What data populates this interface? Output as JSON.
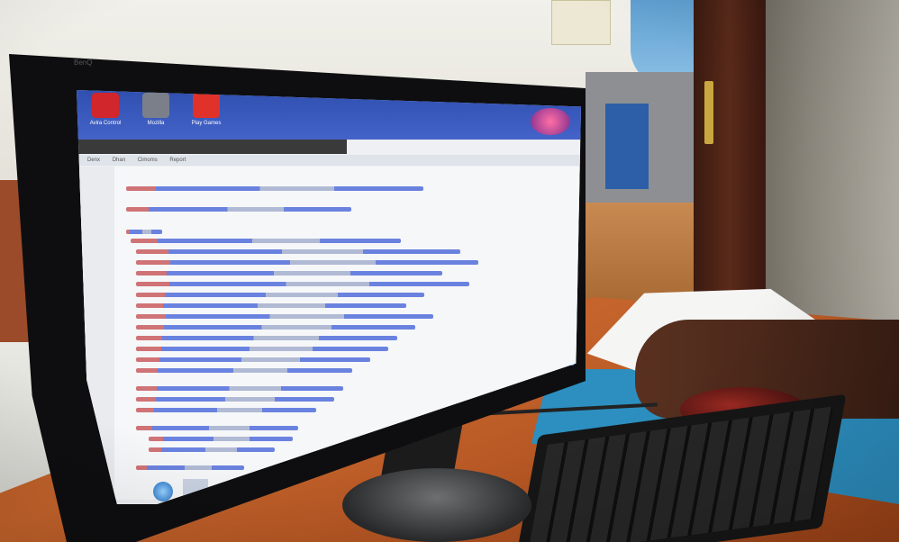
{
  "desktop": {
    "apps": [
      {
        "label": "Avira Control",
        "icon": "avira-icon",
        "color": "#d1262b"
      },
      {
        "label": "Mozilla",
        "icon": "mozilla-icon",
        "color": "#7a7f8a"
      },
      {
        "label": "Play Games",
        "icon": "games-icon",
        "color": "#e0322a"
      }
    ],
    "menu": [
      "Denx",
      "Dhan",
      "Cimoms",
      "Report"
    ]
  },
  "monitor": {
    "brand": "BenQ"
  },
  "colors": {
    "taskbar": "#3b5bc2",
    "desk": "#b8592a",
    "mat": "#2c8fc0"
  }
}
